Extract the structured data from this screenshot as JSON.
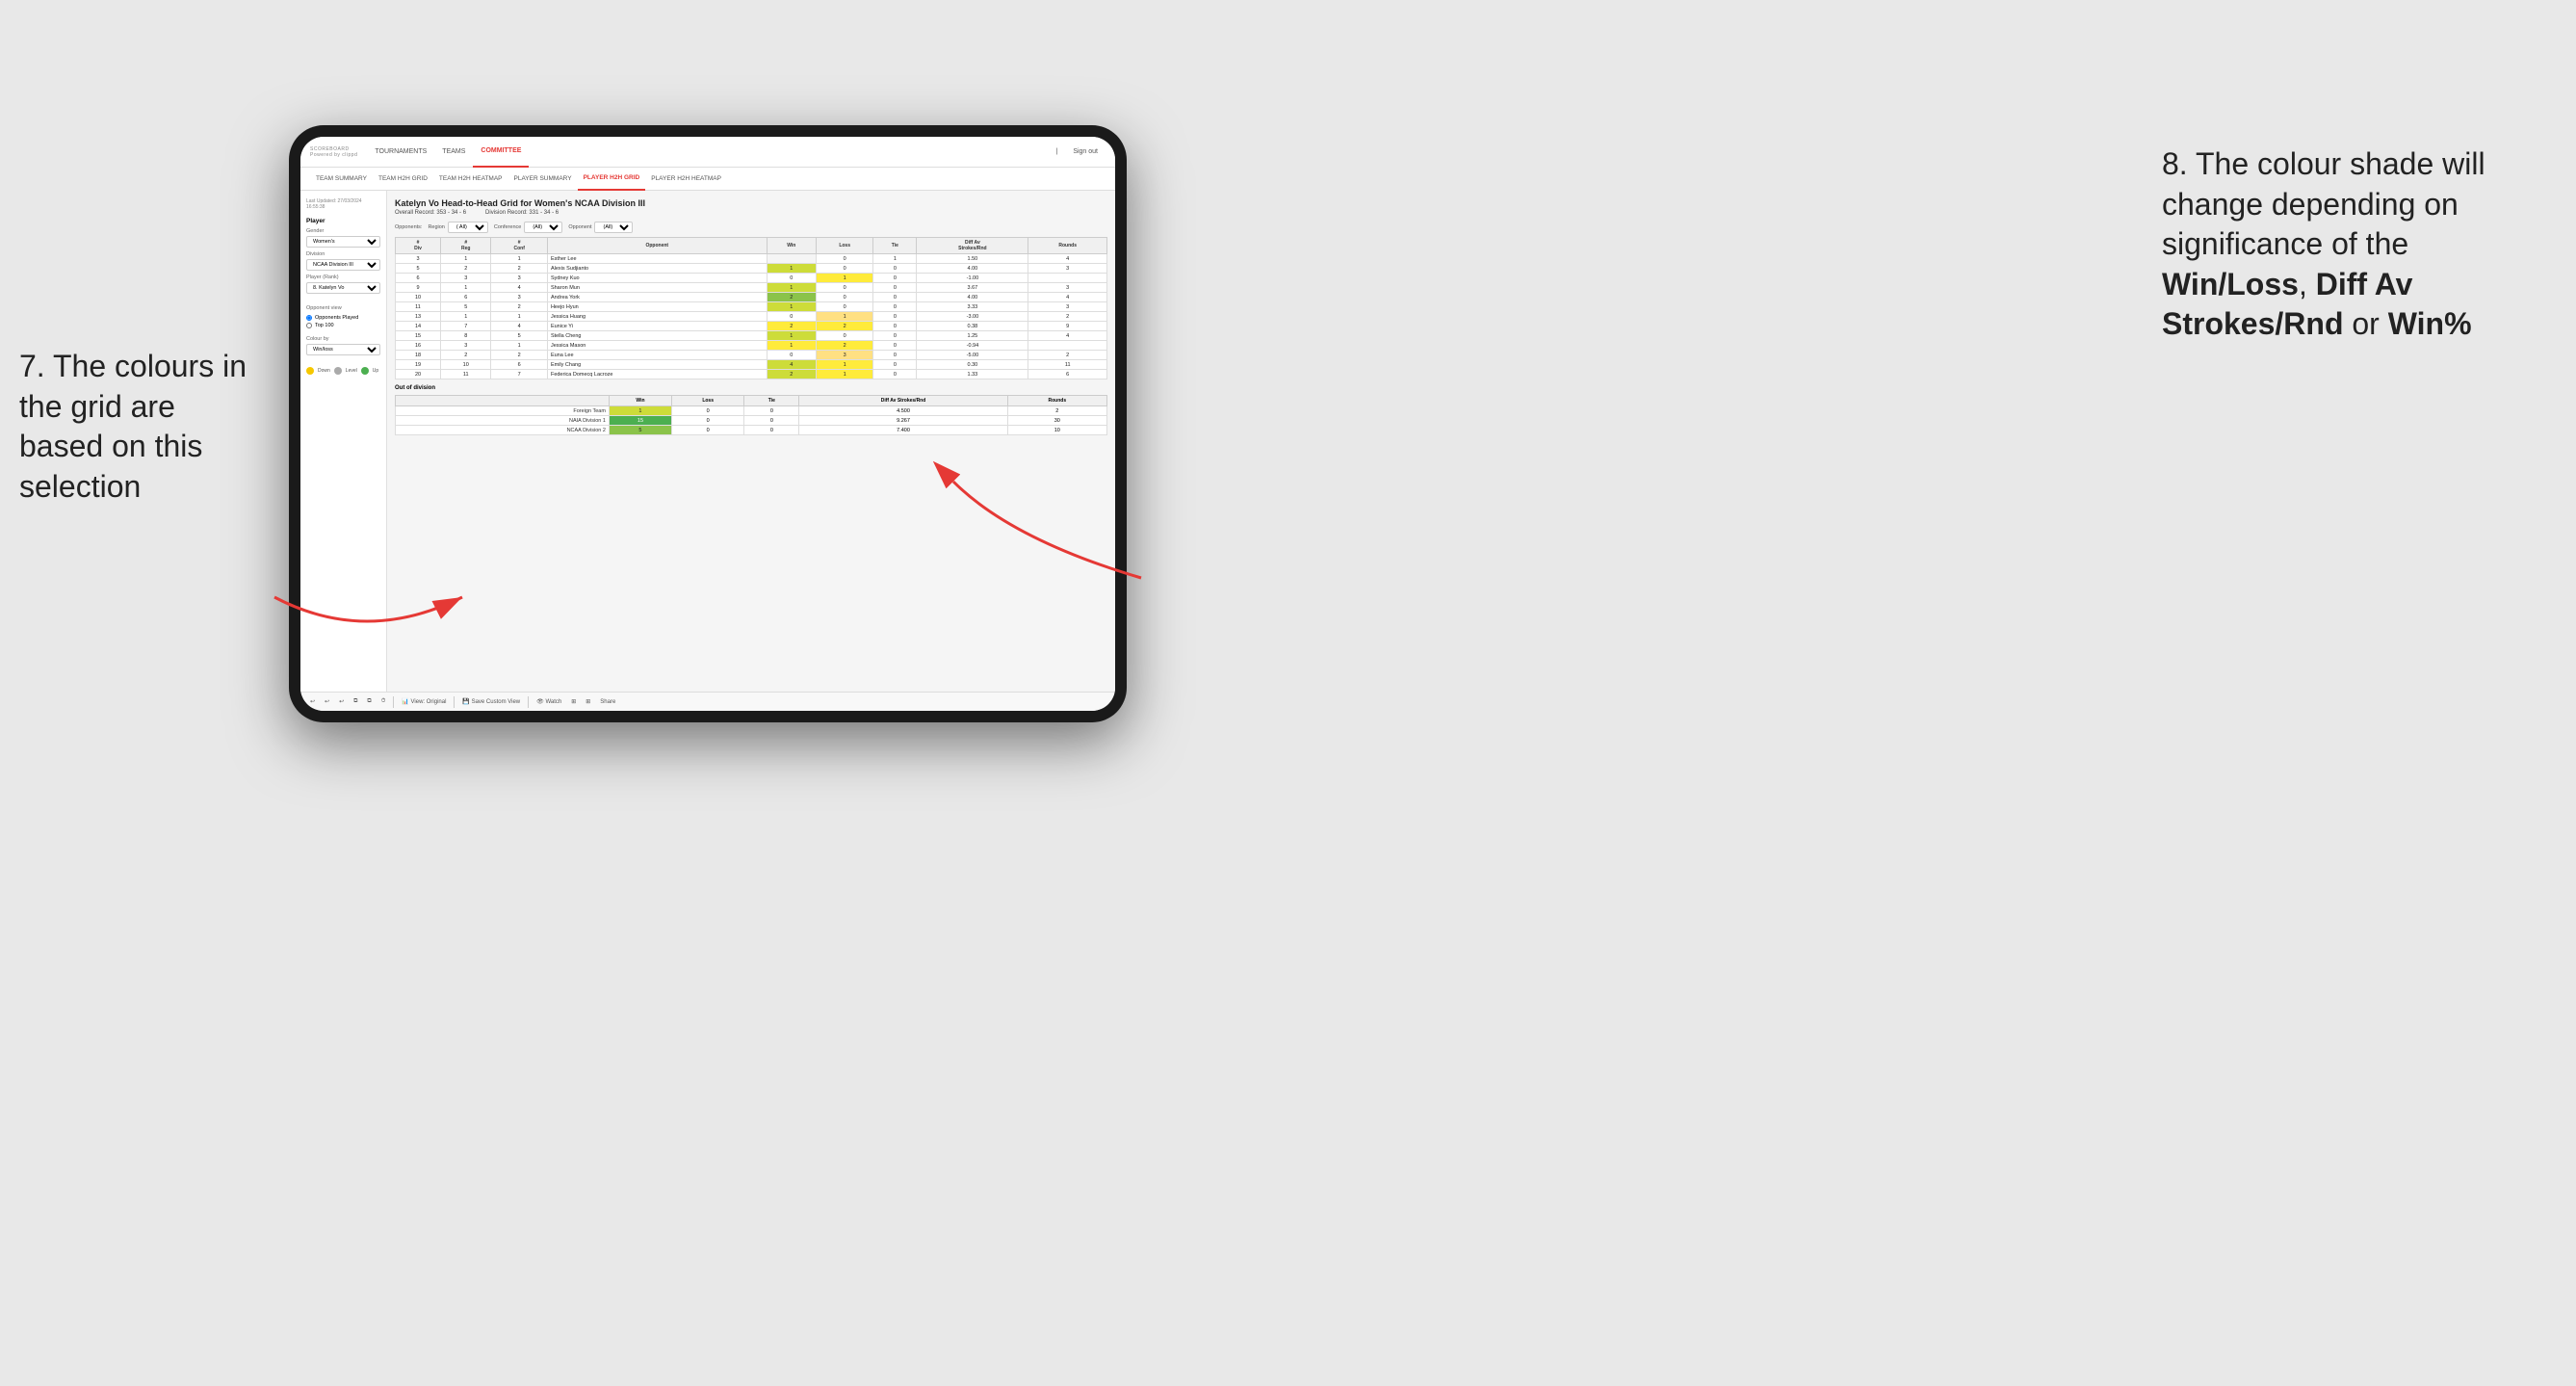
{
  "annotations": {
    "left_text": "7. The colours in the grid are based on this selection",
    "right_text": "8. The colour shade will change depending on significance of the ",
    "right_bold1": "Win/Loss",
    "right_comma": ", ",
    "right_bold2": "Diff Av Strokes/Rnd",
    "right_or": " or ",
    "right_bold3": "Win%"
  },
  "nav": {
    "logo": "SCOREBOARD",
    "logo_sub": "Powered by clippd",
    "items": [
      "TOURNAMENTS",
      "TEAMS",
      "COMMITTEE"
    ],
    "active": "COMMITTEE",
    "sign_out": "Sign out"
  },
  "sub_nav": {
    "items": [
      "TEAM SUMMARY",
      "TEAM H2H GRID",
      "TEAM H2H HEATMAP",
      "PLAYER SUMMARY",
      "PLAYER H2H GRID",
      "PLAYER H2H HEATMAP"
    ],
    "active": "PLAYER H2H GRID"
  },
  "sidebar": {
    "timestamp": "Last Updated: 27/03/2024 16:55:38",
    "section_player": "Player",
    "gender_label": "Gender",
    "gender_value": "Women's",
    "division_label": "Division",
    "division_value": "NCAA Division III",
    "player_rank_label": "Player (Rank)",
    "player_rank_value": "8. Katelyn Vo",
    "opponent_view_label": "Opponent view",
    "radio_opponents": "Opponents Played",
    "radio_top100": "Top 100",
    "colour_by_label": "Colour by",
    "colour_by_value": "Win/loss",
    "legend": [
      {
        "color": "#f6c800",
        "label": "Down"
      },
      {
        "color": "#aaaaaa",
        "label": "Level"
      },
      {
        "color": "#4caf50",
        "label": "Up"
      }
    ]
  },
  "grid": {
    "title": "Katelyn Vo Head-to-Head Grid for Women's NCAA Division III",
    "overall_record_label": "Overall Record:",
    "overall_record_value": "353 - 34 - 6",
    "division_record_label": "Division Record:",
    "division_record_value": "331 - 34 - 6",
    "filter_opponents_label": "Opponents:",
    "filter_region_label": "Region",
    "filter_conference_label": "Conference",
    "filter_opponent_label": "Opponent",
    "filter_all": "(All)",
    "col_headers": [
      "#\nDiv",
      "#\nReg",
      "#\nConf",
      "Opponent",
      "Win",
      "Loss",
      "Tie",
      "Diff Av\nStrokes/Rnd",
      "Rounds"
    ],
    "rows": [
      {
        "div": "3",
        "reg": "1",
        "conf": "1",
        "opponent": "Esther Lee",
        "win": "",
        "loss": "0",
        "tie": "1",
        "diff": "1.50",
        "rounds": "4",
        "win_color": "cell-empty",
        "loss_color": "cell-white",
        "tie_color": "cell-white"
      },
      {
        "div": "5",
        "reg": "2",
        "conf": "2",
        "opponent": "Alexis Sudjianto",
        "win": "1",
        "loss": "0",
        "tie": "0",
        "diff": "4.00",
        "rounds": "3",
        "win_color": "cell-green-light",
        "loss_color": "cell-white",
        "tie_color": "cell-white"
      },
      {
        "div": "6",
        "reg": "3",
        "conf": "3",
        "opponent": "Sydney Kuo",
        "win": "0",
        "loss": "1",
        "tie": "0",
        "diff": "-1.00",
        "rounds": "",
        "win_color": "cell-white",
        "loss_color": "cell-yellow",
        "tie_color": "cell-white"
      },
      {
        "div": "9",
        "reg": "1",
        "conf": "4",
        "opponent": "Sharon Mun",
        "win": "1",
        "loss": "0",
        "tie": "0",
        "diff": "3.67",
        "rounds": "3",
        "win_color": "cell-green-light",
        "loss_color": "cell-white",
        "tie_color": "cell-white"
      },
      {
        "div": "10",
        "reg": "6",
        "conf": "3",
        "opponent": "Andrea York",
        "win": "2",
        "loss": "0",
        "tie": "0",
        "diff": "4.00",
        "rounds": "4",
        "win_color": "cell-green-mid",
        "loss_color": "cell-white",
        "tie_color": "cell-white"
      },
      {
        "div": "11",
        "reg": "5",
        "conf": "2",
        "opponent": "Heejo Hyun",
        "win": "1",
        "loss": "0",
        "tie": "0",
        "diff": "3.33",
        "rounds": "3",
        "win_color": "cell-green-light",
        "loss_color": "cell-white",
        "tie_color": "cell-white"
      },
      {
        "div": "13",
        "reg": "1",
        "conf": "1",
        "opponent": "Jessica Huang",
        "win": "0",
        "loss": "1",
        "tie": "0",
        "diff": "-3.00",
        "rounds": "2",
        "win_color": "cell-white",
        "loss_color": "cell-orange-light",
        "tie_color": "cell-white"
      },
      {
        "div": "14",
        "reg": "7",
        "conf": "4",
        "opponent": "Eunice Yi",
        "win": "2",
        "loss": "2",
        "tie": "0",
        "diff": "0.38",
        "rounds": "9",
        "win_color": "cell-yellow",
        "loss_color": "cell-yellow",
        "tie_color": "cell-white"
      },
      {
        "div": "15",
        "reg": "8",
        "conf": "5",
        "opponent": "Stella Cheng",
        "win": "1",
        "loss": "0",
        "tie": "0",
        "diff": "1.25",
        "rounds": "4",
        "win_color": "cell-green-light",
        "loss_color": "cell-white",
        "tie_color": "cell-white"
      },
      {
        "div": "16",
        "reg": "3",
        "conf": "1",
        "opponent": "Jessica Mason",
        "win": "1",
        "loss": "2",
        "tie": "0",
        "diff": "-0.94",
        "rounds": "",
        "win_color": "cell-yellow",
        "loss_color": "cell-yellow",
        "tie_color": "cell-white"
      },
      {
        "div": "18",
        "reg": "2",
        "conf": "2",
        "opponent": "Euna Lee",
        "win": "0",
        "loss": "3",
        "tie": "0",
        "diff": "-5.00",
        "rounds": "2",
        "win_color": "cell-white",
        "loss_color": "cell-orange-light",
        "tie_color": "cell-white"
      },
      {
        "div": "19",
        "reg": "10",
        "conf": "6",
        "opponent": "Emily Chang",
        "win": "4",
        "loss": "1",
        "tie": "0",
        "diff": "0.30",
        "rounds": "11",
        "win_color": "cell-green-light",
        "loss_color": "cell-yellow",
        "tie_color": "cell-white"
      },
      {
        "div": "20",
        "reg": "11",
        "conf": "7",
        "opponent": "Federica Domecq Lacroze",
        "win": "2",
        "loss": "1",
        "tie": "0",
        "diff": "1.33",
        "rounds": "6",
        "win_color": "cell-green-light",
        "loss_color": "cell-yellow",
        "tie_color": "cell-white"
      }
    ],
    "out_of_division_label": "Out of division",
    "out_of_division_rows": [
      {
        "name": "Foreign Team",
        "win": "1",
        "loss": "0",
        "tie": "0",
        "diff": "4.500",
        "rounds": "2",
        "win_color": "cell-green-light"
      },
      {
        "name": "NAIA Division 1",
        "win": "15",
        "loss": "0",
        "tie": "0",
        "diff": "9.267",
        "rounds": "30",
        "win_color": "cell-green-dark"
      },
      {
        "name": "NCAA Division 2",
        "win": "5",
        "loss": "0",
        "tie": "0",
        "diff": "7.400",
        "rounds": "10",
        "win_color": "cell-green-mid"
      }
    ]
  },
  "toolbar": {
    "view_original": "View: Original",
    "save_custom": "Save Custom View",
    "watch": "Watch",
    "share": "Share"
  }
}
